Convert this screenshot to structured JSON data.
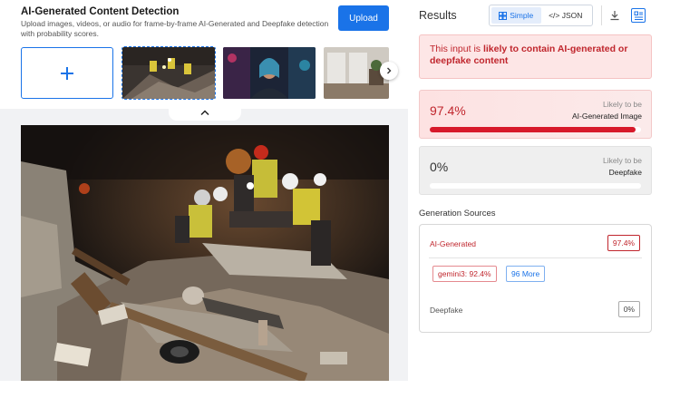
{
  "app": {
    "title": "AI-Generated Content Detection",
    "description": "Upload images, videos, or audio for frame-by-frame AI-Generated and Deepfake detection with probability scores.",
    "upload_label": "Upload"
  },
  "results": {
    "title": "Results",
    "view_options": [
      {
        "label": "Simple",
        "active": true,
        "icon": "layout-icon"
      },
      {
        "label": "</> JSON",
        "active": false,
        "icon": "code-icon"
      }
    ],
    "alert": {
      "prefix": "This input is ",
      "emphasis": "likely to contain AI-generated or deepfake content"
    },
    "ai_generated": {
      "value": "97.4%",
      "fraction": 0.974,
      "caption": "Likely to be",
      "label": "AI-Generated Image"
    },
    "deepfake": {
      "value": "0%",
      "fraction": 0.0,
      "caption": "Likely to be",
      "label": "Deepfake"
    },
    "generation_sources": {
      "title": "Generation Sources",
      "ai_label": "AI-Generated",
      "ai_value": "97.4%",
      "model_tag": "gemini3: 92.4%",
      "more_tag": "96 More",
      "deepfake_label": "Deepfake",
      "deepfake_value": "0%"
    }
  },
  "colors": {
    "accent": "#1a73e8",
    "danger": "#c0262d",
    "danger_bar": "#d7192a"
  }
}
